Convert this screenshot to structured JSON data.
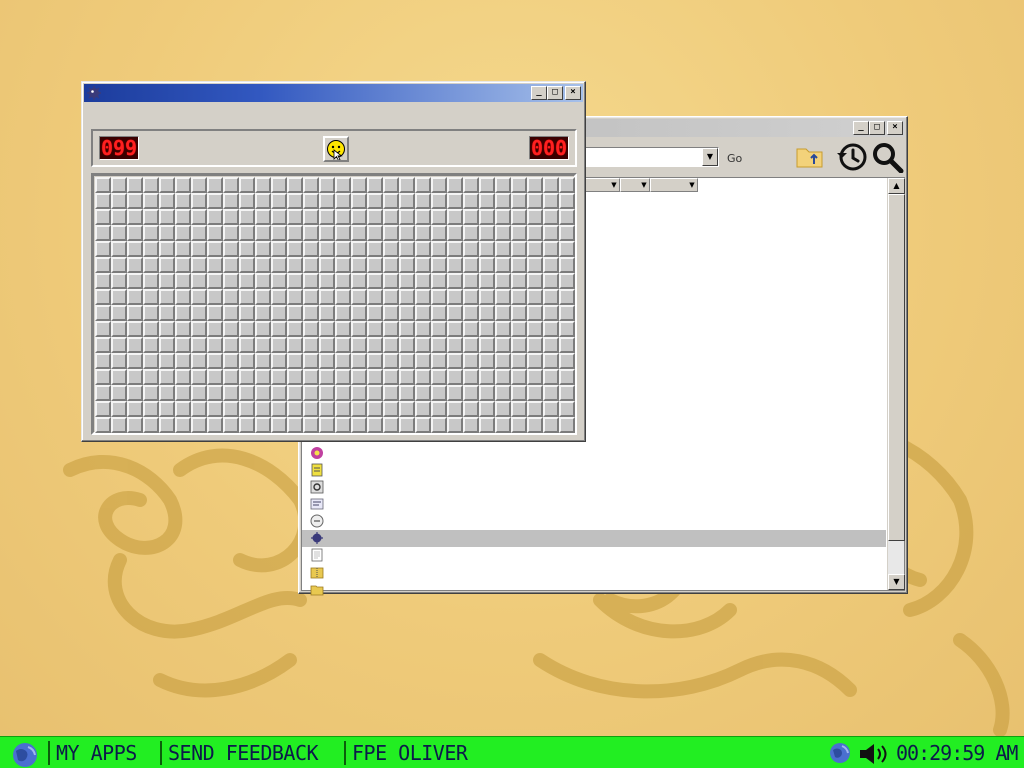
{
  "minesweeper": {
    "title": "",
    "menu": [
      "",
      ""
    ],
    "mine_counter": "099",
    "timer": "000",
    "smiley_state": "smile",
    "rows": 16,
    "cols": 30,
    "controls": {
      "minimize": "_",
      "maximize": "□",
      "close": "×"
    }
  },
  "explorer": {
    "title": "",
    "address_value": "",
    "go_label": "Go",
    "controls": {
      "minimize": "_",
      "maximize": "□",
      "close": "×"
    },
    "columns": [
      "",
      "",
      "",
      ""
    ],
    "files": [
      {
        "name": "",
        "modified": "",
        "type": "",
        "size": "",
        "icon": "blank-icon"
      },
      {
        "name": "",
        "modified": "",
        "type": "",
        "size": "",
        "icon": "blank-icon"
      },
      {
        "name": "",
        "modified": "",
        "type": "",
        "size": "",
        "icon": "blank-icon"
      },
      {
        "name": "",
        "modified": "",
        "type": "",
        "size": "",
        "icon": "blank-icon"
      },
      {
        "name": "",
        "modified": "",
        "type": "",
        "size": "",
        "icon": "blank-icon"
      },
      {
        "name": "",
        "modified": "",
        "type": "",
        "size": "",
        "icon": "blank-icon"
      },
      {
        "name": "",
        "modified": "",
        "type": "",
        "size": "",
        "icon": "flower-app-icon"
      },
      {
        "name": "",
        "modified": "",
        "type": "",
        "size": "",
        "icon": "file-icon"
      },
      {
        "name": "",
        "modified": "",
        "type": "",
        "size": "",
        "icon": "settings-file-icon"
      },
      {
        "name": "",
        "modified": "",
        "type": "",
        "size": "",
        "icon": "config-icon"
      },
      {
        "name": "",
        "modified": "",
        "type": "",
        "size": "",
        "icon": "app-icon"
      },
      {
        "name": "",
        "modified": "",
        "type": "",
        "size": "",
        "icon": "mines-app-icon",
        "selected": true
      },
      {
        "name": "",
        "modified": "",
        "type": "",
        "size": "",
        "icon": "text-document-icon"
      },
      {
        "name": "",
        "modified": "",
        "type": "",
        "size": "",
        "icon": "zip-folder-icon"
      },
      {
        "name": "",
        "modified": "",
        "type": "",
        "size": "",
        "icon": "folder-icon"
      }
    ]
  },
  "taskbar": {
    "items": [
      "MY APPS",
      "SEND FEEDBACK",
      "FPE OLIVER"
    ],
    "clock": "00:29:59 AM"
  },
  "colors": {
    "desktop_bg": "#f0cc78",
    "taskbar_bg": "#22ee22",
    "taskbar_text": "#0c1a4a",
    "active_title": "#1c3c9c",
    "led_red": "#ff2020",
    "file_text": "#1a1aa6"
  }
}
